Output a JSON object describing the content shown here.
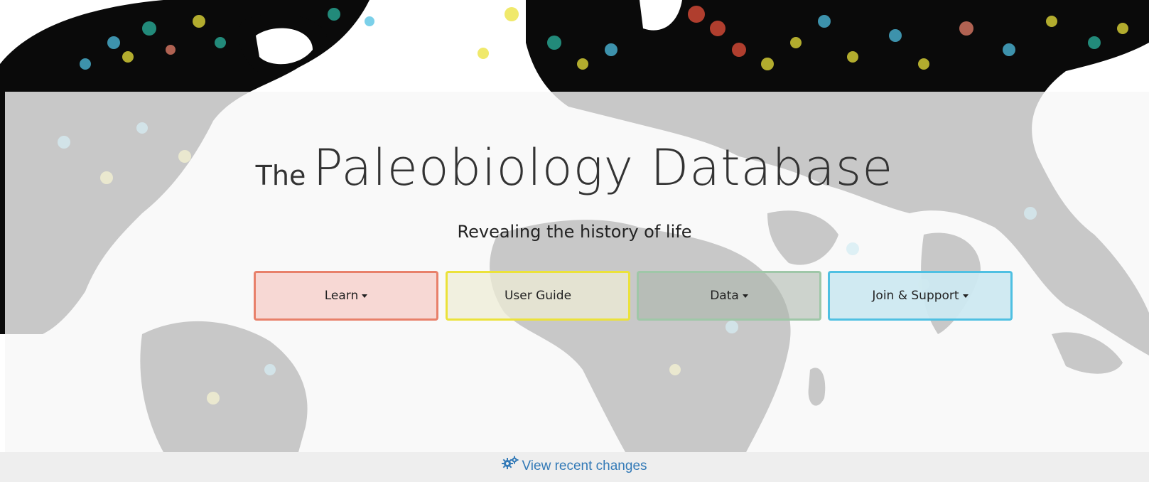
{
  "hero": {
    "title_prefix": "The",
    "title_main": "Paleobiology Database",
    "subtitle": "Revealing the history of life"
  },
  "buttons": {
    "learn": "Learn",
    "user_guide": "User Guide",
    "data": "Data",
    "join_support": "Join & Support"
  },
  "footer": {
    "link_label": "View recent changes",
    "link_icon": "cogs-icon"
  },
  "colors": {
    "learn_border": "#e8806a",
    "user_guide_border": "#ebe23a",
    "data_border": "#9fc7a8",
    "join_border": "#4fc0e2",
    "link": "#337ab7"
  }
}
